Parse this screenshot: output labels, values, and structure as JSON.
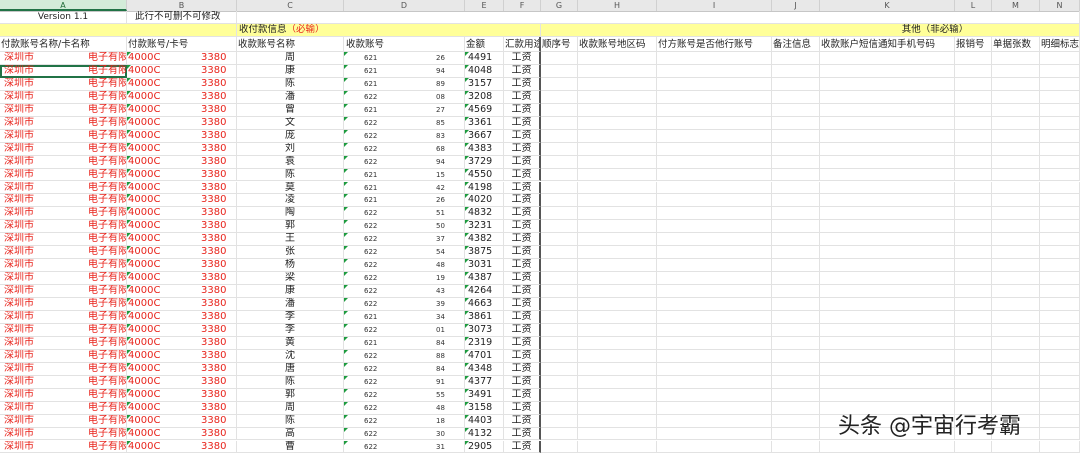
{
  "columns": [
    "A",
    "B",
    "C",
    "D",
    "E",
    "F",
    "G",
    "H",
    "I",
    "J",
    "K",
    "L",
    "M",
    "N"
  ],
  "selected_column": "A",
  "meta": {
    "version": "Version 1.1",
    "note": "此行不可删不可修改"
  },
  "group_headers": {
    "payee_info": "收付款信息",
    "payee_required": "（必输）",
    "other_info": "其他（非必输）"
  },
  "headers": {
    "A": "付款账号名称/卡名称",
    "B": "付款账号/卡号",
    "C": "收款账号名称",
    "D": "收款账号",
    "E": "金额",
    "F": "汇款用途",
    "G": "顺序号",
    "H": "收款账号地区码",
    "I": "付方账号是否他行账号",
    "J": "备注信息",
    "K": "收款账户短信通知手机号码",
    "L": "报销号",
    "M": "单据张数",
    "N": "明细标志"
  },
  "rows": [
    {
      "a1": "深圳市",
      "a2": "电子有限",
      "b1": "4000C",
      "b2": "3380",
      "c": "周",
      "d1": "621",
      "d2": "26",
      "e": "4491",
      "f": "工资"
    },
    {
      "a1": "深圳市",
      "a2": "电子有限",
      "b1": "4000C",
      "b2": "3380",
      "c": "康",
      "d1": "621",
      "d2": "94",
      "e": "4048",
      "f": "工资"
    },
    {
      "a1": "深圳市",
      "a2": "电子有限",
      "b1": "4000C",
      "b2": "3380",
      "c": "陈",
      "d1": "621",
      "d2": "89",
      "e": "3157",
      "f": "工资"
    },
    {
      "a1": "深圳市",
      "a2": "电子有限",
      "b1": "4000C",
      "b2": "3380",
      "c": "潘",
      "d1": "622",
      "d2": "08",
      "e": "3208",
      "f": "工资"
    },
    {
      "a1": "深圳市",
      "a2": "电子有限",
      "b1": "4000C",
      "b2": "3380",
      "c": "曾",
      "d1": "621",
      "d2": "27",
      "e": "4569",
      "f": "工资"
    },
    {
      "a1": "深圳市",
      "a2": "电子有限",
      "b1": "4000C",
      "b2": "3380",
      "c": "文",
      "d1": "622",
      "d2": "85",
      "e": "3361",
      "f": "工资"
    },
    {
      "a1": "深圳市",
      "a2": "电子有限",
      "b1": "4000C",
      "b2": "3380",
      "c": "庞",
      "d1": "622",
      "d2": "83",
      "e": "3667",
      "f": "工资"
    },
    {
      "a1": "深圳市",
      "a2": "电子有限",
      "b1": "4000C",
      "b2": "3380",
      "c": "刘",
      "d1": "622",
      "d2": "68",
      "e": "4383",
      "f": "工资"
    },
    {
      "a1": "深圳市",
      "a2": "电子有限",
      "b1": "4000C",
      "b2": "3380",
      "c": "袁",
      "d1": "622",
      "d2": "94",
      "e": "3729",
      "f": "工资"
    },
    {
      "a1": "深圳市",
      "a2": "电子有限",
      "b1": "4000C",
      "b2": "3380",
      "c": "陈",
      "d1": "621",
      "d2": "15",
      "e": "4550",
      "f": "工资"
    },
    {
      "a1": "深圳市",
      "a2": "电子有限",
      "b1": "4000C",
      "b2": "3380",
      "c": "莫",
      "d1": "621",
      "d2": "42",
      "e": "4198",
      "f": "工资"
    },
    {
      "a1": "深圳市",
      "a2": "电子有限",
      "b1": "4000C",
      "b2": "3380",
      "c": "凌",
      "d1": "621",
      "d2": "26",
      "e": "4020",
      "f": "工资"
    },
    {
      "a1": "深圳市",
      "a2": "电子有限",
      "b1": "4000C",
      "b2": "3380",
      "c": "陶",
      "d1": "622",
      "d2": "51",
      "e": "4832",
      "f": "工资"
    },
    {
      "a1": "深圳市",
      "a2": "电子有限",
      "b1": "4000C",
      "b2": "3380",
      "c": "郭",
      "d1": "622",
      "d2": "50",
      "e": "3231",
      "f": "工资"
    },
    {
      "a1": "深圳市",
      "a2": "电子有限",
      "b1": "4000C",
      "b2": "3380",
      "c": "王",
      "d1": "622",
      "d2": "37",
      "e": "4382",
      "f": "工资"
    },
    {
      "a1": "深圳市",
      "a2": "电子有限",
      "b1": "4000C",
      "b2": "3380",
      "c": "张",
      "d1": "622",
      "d2": "54",
      "e": "3875",
      "f": "工资"
    },
    {
      "a1": "深圳市",
      "a2": "电子有限",
      "b1": "4000C",
      "b2": "3380",
      "c": "杨",
      "d1": "622",
      "d2": "48",
      "e": "3031",
      "f": "工资"
    },
    {
      "a1": "深圳市",
      "a2": "电子有限",
      "b1": "4000C",
      "b2": "3380",
      "c": "梁",
      "d1": "622",
      "d2": "19",
      "e": "4387",
      "f": "工资"
    },
    {
      "a1": "深圳市",
      "a2": "电子有限",
      "b1": "4000C",
      "b2": "3380",
      "c": "康",
      "d1": "622",
      "d2": "43",
      "e": "4264",
      "f": "工资"
    },
    {
      "a1": "深圳市",
      "a2": "电子有限",
      "b1": "4000C",
      "b2": "3380",
      "c": "潘",
      "d1": "622",
      "d2": "39",
      "e": "4663",
      "f": "工资"
    },
    {
      "a1": "深圳市",
      "a2": "电子有限",
      "b1": "4000C",
      "b2": "3380",
      "c": "李",
      "d1": "621",
      "d2": "34",
      "e": "3861",
      "f": "工资"
    },
    {
      "a1": "深圳市",
      "a2": "电子有限",
      "b1": "4000C",
      "b2": "3380",
      "c": "李",
      "d1": "622",
      "d2": "01",
      "e": "3073",
      "f": "工资"
    },
    {
      "a1": "深圳市",
      "a2": "电子有限",
      "b1": "4000C",
      "b2": "3380",
      "c": "黄",
      "d1": "621",
      "d2": "84",
      "e": "2319",
      "f": "工资"
    },
    {
      "a1": "深圳市",
      "a2": "电子有限",
      "b1": "4000C",
      "b2": "3380",
      "c": "沈",
      "d1": "622",
      "d2": "88",
      "e": "4701",
      "f": "工资"
    },
    {
      "a1": "深圳市",
      "a2": "电子有限",
      "b1": "4000C",
      "b2": "3380",
      "c": "唐",
      "d1": "622",
      "d2": "84",
      "e": "4348",
      "f": "工资"
    },
    {
      "a1": "深圳市",
      "a2": "电子有限",
      "b1": "4000C",
      "b2": "3380",
      "c": "陈",
      "d1": "622",
      "d2": "91",
      "e": "4377",
      "f": "工资"
    },
    {
      "a1": "深圳市",
      "a2": "电子有限",
      "b1": "4000C",
      "b2": "3380",
      "c": "郭",
      "d1": "622",
      "d2": "55",
      "e": "3491",
      "f": "工资"
    },
    {
      "a1": "深圳市",
      "a2": "电子有限",
      "b1": "4000C",
      "b2": "3380",
      "c": "周",
      "d1": "622",
      "d2": "48",
      "e": "3158",
      "f": "工资"
    },
    {
      "a1": "深圳市",
      "a2": "电子有限",
      "b1": "4000C",
      "b2": "3380",
      "c": "陈",
      "d1": "622",
      "d2": "18",
      "e": "4403",
      "f": "工资"
    },
    {
      "a1": "深圳市",
      "a2": "电子有限",
      "b1": "4000C",
      "b2": "3380",
      "c": "高",
      "d1": "622",
      "d2": "30",
      "e": "4132",
      "f": "工资"
    },
    {
      "a1": "深圳市",
      "a2": "电子有限",
      "b1": "4000C",
      "b2": "3380",
      "c": "曹",
      "d1": "622",
      "d2": "31",
      "e": "2905",
      "f": "工资"
    }
  ],
  "watermark": "头条 @宇宙行考霸"
}
